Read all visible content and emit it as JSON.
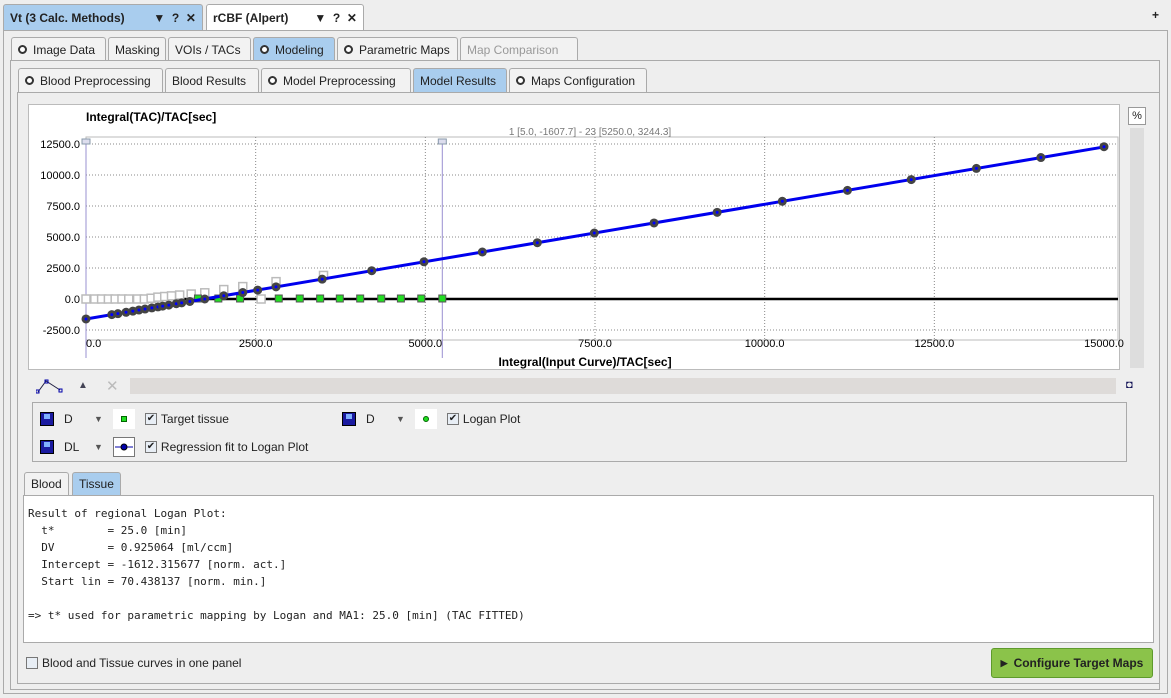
{
  "top_tabs": [
    {
      "label": "Vt (3 Calc. Methods)",
      "selected": true
    },
    {
      "label": "rCBF (Alpert)",
      "selected": false
    }
  ],
  "add_tab": "+",
  "main_tabs": [
    {
      "label": "Image Data",
      "icon": true
    },
    {
      "label": "Masking"
    },
    {
      "label": "VOIs / TACs"
    },
    {
      "label": "Modeling",
      "icon": true,
      "selected": true
    },
    {
      "label": "Parametric Maps",
      "icon": true
    },
    {
      "label": "Map Comparison",
      "disabled": true
    }
  ],
  "sub_tabs": [
    {
      "label": "Blood Preprocessing",
      "icon": true
    },
    {
      "label": "Blood Results"
    },
    {
      "label": "Model Preprocessing",
      "icon": true
    },
    {
      "label": "Model Results",
      "selected": true
    },
    {
      "label": "Maps Configuration",
      "icon": true
    }
  ],
  "chart_data": {
    "type": "scatter",
    "ylabel": "Integral(TAC)/TAC[sec]",
    "xlabel": "Integral(Input Curve)/TAC[sec]",
    "range_label": "1 [5.0, -1607.7] - 23 [5250.0, 3244.3]",
    "xlim": [
      0,
      15000
    ],
    "ylim": [
      -2500,
      12500
    ],
    "xticks": [
      "0.0",
      "2500.0",
      "5000.0",
      "7500.0",
      "10000.0",
      "12500.0",
      "15000.0"
    ],
    "yticks": [
      "-2500.0",
      "0.0",
      "2500.0",
      "5000.0",
      "7500.0",
      "10000.0",
      "12500.0"
    ],
    "grid": true,
    "markers_x": [
      0,
      5250
    ],
    "series": [
      {
        "name": "Logan Plot",
        "color": "#444444",
        "x": [
          0,
          380,
          470,
          590,
          690,
          780,
          870,
          970,
          1060,
          1130,
          1220,
          1330,
          1410,
          1530,
          1750,
          2030,
          2310,
          2530,
          2800,
          3480,
          4210,
          4980,
          5840,
          6650,
          7490,
          8370,
          9300,
          10260,
          11220,
          12160,
          13120,
          14070,
          15000
        ],
        "y": [
          -1610,
          -1260,
          -1180,
          -1070,
          -980,
          -890,
          -810,
          -720,
          -640,
          -570,
          -490,
          -380,
          -310,
          -200,
          0,
          260,
          520,
          720,
          980,
          1600,
          2280,
          3000,
          3790,
          4540,
          5320,
          6130,
          6990,
          7880,
          8760,
          9630,
          10530,
          11410,
          12280
        ]
      },
      {
        "name": "excluded",
        "color": "#bbbbbb",
        "x": [
          0,
          130,
          230,
          330,
          430,
          530,
          630,
          760,
          860,
          960,
          1060,
          1160,
          1260,
          1380,
          1550,
          1750,
          2030,
          2310,
          2580,
          2800,
          3500
        ],
        "y": [
          0,
          0,
          0,
          0,
          0,
          0,
          0,
          0,
          0,
          60,
          150,
          200,
          250,
          320,
          400,
          500,
          760,
          1000,
          0,
          1400,
          1900
        ]
      },
      {
        "name": "Target tissue",
        "color": "#22dd22",
        "x": [
          1650,
          1950,
          2270,
          2840,
          3150,
          3450,
          3740,
          4040,
          4350,
          4640,
          4940,
          5250
        ],
        "y": [
          40,
          40,
          40,
          40,
          40,
          40,
          40,
          40,
          40,
          40,
          40,
          40
        ]
      },
      {
        "name": "Regression fit to Logan Plot",
        "type": "line",
        "color": "#0000ee",
        "slope": 0.925064,
        "intercept": -1612.315677
      }
    ]
  },
  "legend": [
    {
      "style": "D",
      "label": "Target tissue",
      "checked": true,
      "color": "#22dd22"
    },
    {
      "style": "D",
      "label": "Logan Plot",
      "checked": true,
      "color": "#22dd22"
    },
    {
      "style": "DL",
      "label": "Regression fit to Logan Plot",
      "checked": true,
      "color": "#0000ee"
    }
  ],
  "percent_button": "%",
  "result_tabs": [
    {
      "label": "Blood"
    },
    {
      "label": "Tissue",
      "selected": true
    }
  ],
  "result_lines": [
    "Result of regional Logan Plot:",
    "  t*        = 25.0 [min]",
    "  DV        = 0.925064 [ml/ccm]",
    "  Intercept = -1612.315677 [norm. act.]",
    "  Start lin = 70.438137 [norm. min.]",
    "",
    "=> t* used for parametric mapping by Logan and MA1: 25.0 [min] (TAC FITTED)"
  ],
  "one_panel_label": "Blood and Tissue curves in one panel",
  "configure_button": "Configure Target Maps"
}
